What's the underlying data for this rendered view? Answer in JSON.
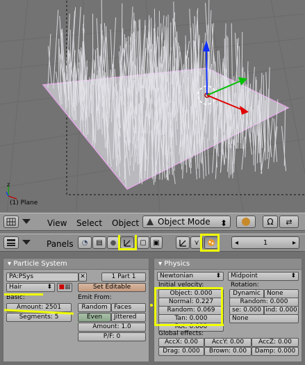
{
  "viewport": {
    "object_label": "(1) Plane"
  },
  "header3d": {
    "menus": [
      "View",
      "Select",
      "Object"
    ],
    "mode": "Object Mode"
  },
  "buttons_header": {
    "panels_label": "Panels",
    "frame": "1"
  },
  "particle_system": {
    "title": "Particle System",
    "name": "PA:PSys",
    "part": "1 Part 1",
    "type": "Hair",
    "set_editable": "Set Editable",
    "basic_label": "Basic:",
    "amount": "Amount: 2501",
    "segments": "Segments: 5",
    "emit_from_label": "Emit From:",
    "random": "Random",
    "faces": "Faces",
    "even": "Even",
    "jittered": "Jittered",
    "emit_amount": "Amount: 1.0",
    "pf": "P/F: 0"
  },
  "physics": {
    "title": "Physics",
    "type": "Newtonian",
    "integrator": "Midpoint",
    "initial_velocity_label": "Initial velocity:",
    "object": "Object: 0.000",
    "normal": "Normal: 0.227",
    "random": "Random: 0.069",
    "tan": "Tan: 0.000",
    "rot": "Rot: 0.000",
    "rotation_label": "Rotation:",
    "dynamic": "Dynamic",
    "none1": "None",
    "rot_random": "Random: 0.000",
    "se": "se: 0.000",
    "ind": "ind: 0.000",
    "none2": "None",
    "global_effects_label": "Global effects:",
    "accx": "AccX: 0.00",
    "accy": "AccY: 0.00",
    "accz": "AccZ: 0.00",
    "drag": "Drag: 0.000",
    "brown": "Brown: 0.00",
    "damp": "Damp: 0.000"
  },
  "colors": {
    "highlight": "#f0ff00",
    "axis_x": "#e00000",
    "axis_y": "#00c000",
    "axis_z": "#1030ff"
  }
}
